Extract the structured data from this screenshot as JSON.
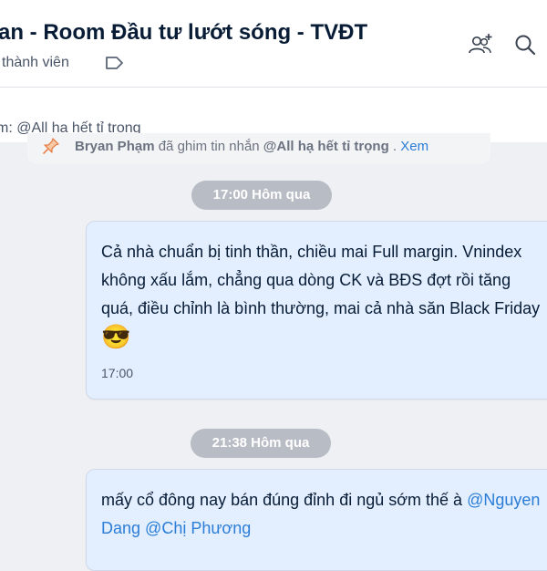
{
  "header": {
    "title": "an - Room Đầu tư lướt sóng - TVĐT",
    "members": "thành viên",
    "icons": [
      "tag-icon",
      "add-member-icon",
      "search-icon"
    ]
  },
  "pinned": {
    "preview": "m: @All hạ hết tỉ trọng",
    "notice_user": "Bryan Phạm",
    "notice_action": " đã ghim tin nhắn ",
    "notice_msg": "@All hạ hết tỉ trọng",
    "notice_sep": " . ",
    "notice_link": "Xem"
  },
  "messages": [
    {
      "divider": "17:00 Hôm qua",
      "lines": [
        "Cả nhà chuẩn bị tinh thần, chiều mai Full margin. Vnindex",
        "không xấu lắm, chẳng qua dòng CK và BĐS đợt rồi tăng",
        "quá, điều chỉnh là bình thường, mai cả nhà săn Black Friday"
      ],
      "emoji": "😎",
      "time": "17:00"
    },
    {
      "divider": "21:38 Hôm qua",
      "line1_prefix": "mấy cổ đông nay bán đúng đỉnh đi ngủ sớm thế à ",
      "line1_mention": "@Nguyen",
      "line2_mention_a": "Dang",
      "line2_sep": " ",
      "line2_mention_b": "@Chị Phương"
    }
  ],
  "colors": {
    "accent": "#2b7dd6",
    "bubble": "#e3efff",
    "background": "#eef0f4"
  }
}
